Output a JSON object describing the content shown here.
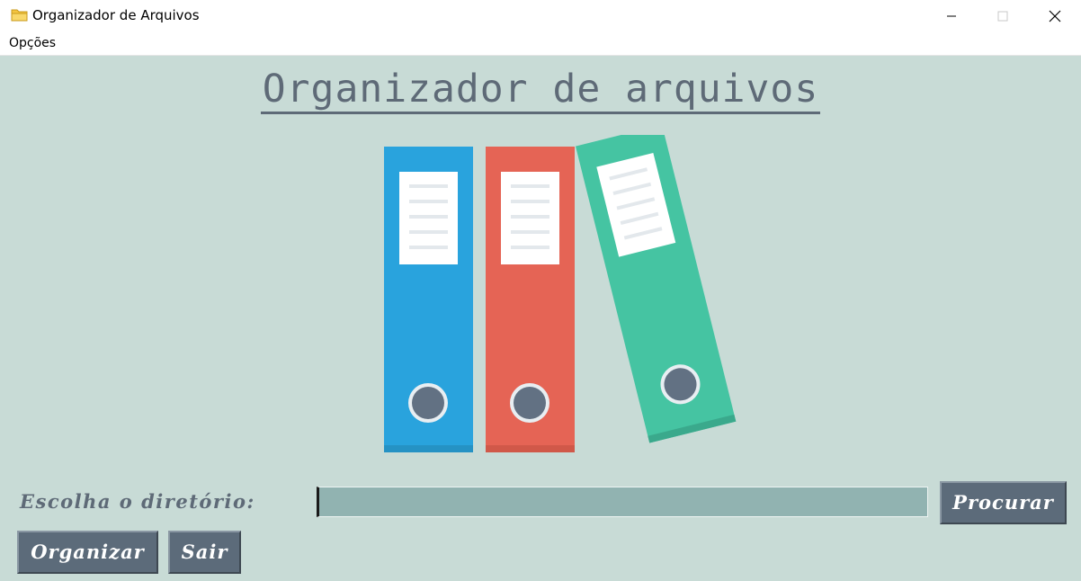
{
  "window": {
    "title": "Organizador de Arquivos",
    "icon": "folder-icon",
    "controls": [
      "minimize-icon",
      "maximize-icon",
      "close-icon"
    ]
  },
  "menu": {
    "items": [
      {
        "label": "Opções"
      }
    ]
  },
  "main": {
    "heading": "Organizador de arquivos",
    "illustration": "binders-icon",
    "directory_label": "Escolha o diretório:",
    "directory_input": {
      "value": "",
      "placeholder": ""
    },
    "browse_button": "Procurar",
    "organize_button": "Organizar",
    "exit_button": "Sair"
  },
  "colors": {
    "background": "#c8dbd6",
    "heading": "#5e6a77",
    "button": "#5c6b7a",
    "input": "#91b3b1",
    "binder_blue": "#29a3dd",
    "binder_red": "#e56455",
    "binder_green": "#45c4a2"
  }
}
